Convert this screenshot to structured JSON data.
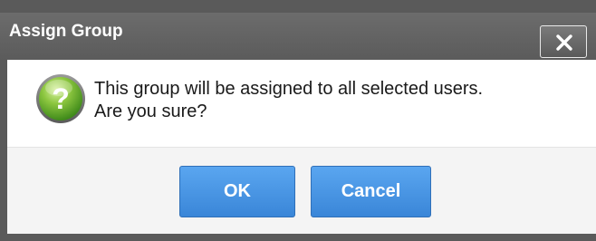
{
  "dialog": {
    "title": "Assign Group",
    "close_icon": "close-x-icon",
    "message_icon": "question-mark-icon",
    "message_line1": "This group will be assigned to all selected users.",
    "message_line2": "Are you sure?",
    "ok_label": "OK",
    "cancel_label": "Cancel"
  },
  "colors": {
    "titlebar": "#5f5f5f",
    "button_blue": "#3f8ddf",
    "icon_green": "#6ab82e"
  }
}
